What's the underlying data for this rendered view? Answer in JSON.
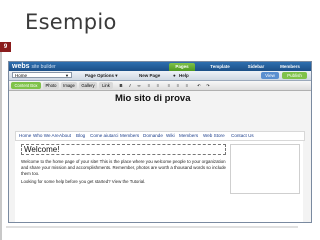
{
  "slide": {
    "title": "Esempio",
    "number": "9"
  },
  "builder": {
    "logo": "webs",
    "logo_sub": "site builder",
    "top_tabs": [
      {
        "label": "Pages",
        "active": true
      },
      {
        "label": "Template",
        "active": false
      },
      {
        "label": "Sidebar",
        "active": false
      },
      {
        "label": "Members",
        "active": false
      }
    ],
    "page_select": "Home",
    "page_options": "Page Options ▾",
    "new_page": "New Page",
    "help": "Help",
    "view_button": "View",
    "publish_button": "Publish",
    "format_buttons": [
      "Content Box",
      "Photo",
      "Image",
      "Gallery",
      "Link",
      "Bold",
      "Italic",
      "Link",
      "Bullet",
      "Num",
      "Left",
      "Center",
      "Right",
      "Undo",
      "Redo"
    ]
  },
  "site": {
    "title": "Mio sito di prova",
    "nav": [
      "Home",
      "Who We Are",
      "About",
      "Blog",
      "Come aiutarci",
      "Members",
      "Domande",
      "Wiki",
      "Members",
      "Web Store",
      "Contact Us"
    ],
    "welcome": "Welcome!",
    "para1": "Welcome to the home page of your site! This is the place where you welcome people to your organization and share your mission and accomplishments. Remember, photos are worth a thousand words so include them too.",
    "para2": "Looking for some help before you get started? View the Tutorial."
  }
}
